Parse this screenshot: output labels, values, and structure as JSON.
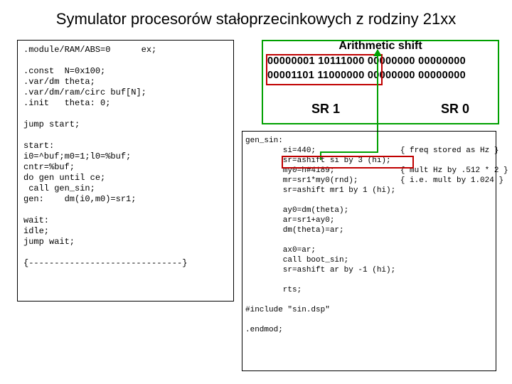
{
  "title": "Symulator procesorów stałoprzecinkowych z rodziny 21xx",
  "left_code": ".module/RAM/ABS=0      ex;\n\n.const  N=0x100;\n.var/dm theta;\n.var/dm/ram/circ buf[N];\n.init   theta: 0;\n\njump start;\n\nstart:\ni0=^buf;m0=1;l0=%buf;\ncntr=%buf;\ndo gen until ce;\n call gen_sin;\ngen:    dm(i0,m0)=sr1;\n\nwait:\nidle;\njump wait;\n\n{------------------------------}",
  "arith": {
    "title": "Arithmetic shift",
    "bits_row1": "00000001 10111000 00000000 00000000",
    "bits_row2": "00001101 11000000 00000000 00000000",
    "sr1": "SR 1",
    "sr0": "SR 0"
  },
  "right_code": "gen_sin:\n        si=440;                  { freq stored as Hz }\n        sr=ashift si by 3 (hi);\n        my0=h#4189;              { mult Hz by .512 * 2 }\n        mr=sr1*my0(rnd);         { i.e. mult by 1.024 }\n        sr=ashift mr1 by 1 (hi);\n\n        ay0=dm(theta);\n        ar=sr1+ay0;\n        dm(theta)=ar;\n\n        ax0=ar;\n        call boot_sin;\n        sr=ashift ar by -1 (hi);\n\n        rts;\n\n#include \"sin.dsp\"\n\n.endmod;"
}
